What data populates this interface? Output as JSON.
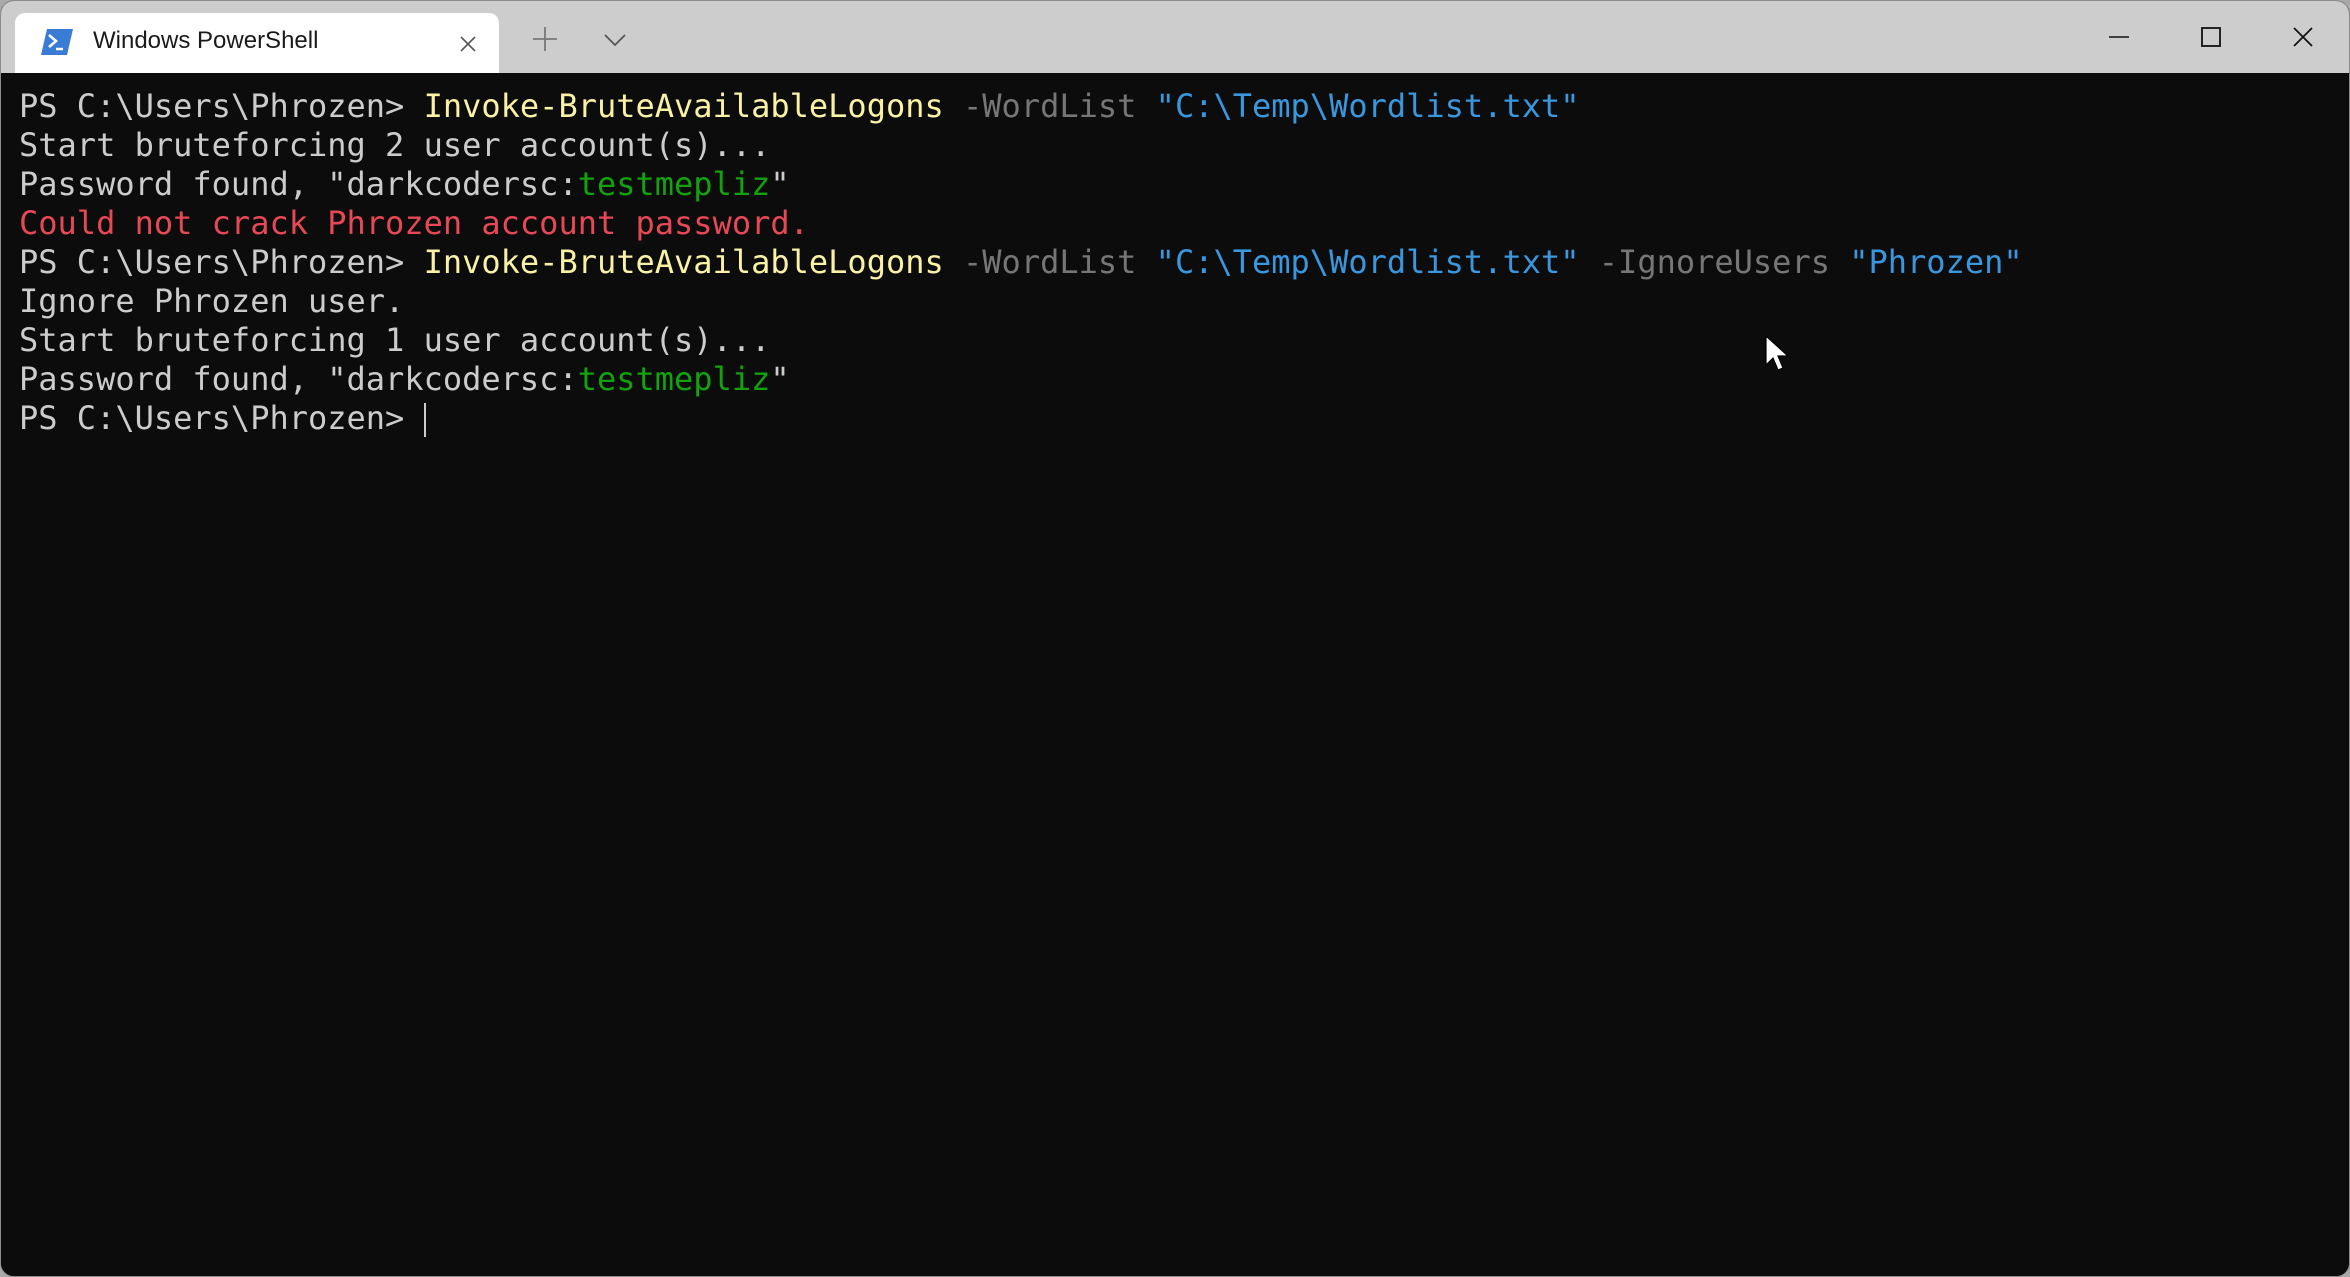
{
  "window": {
    "tab": {
      "title": "Windows PowerShell",
      "icon": "powershell-icon",
      "close_icon": "close-icon"
    },
    "new_tab_icon": "plus-icon",
    "dropdown_icon": "chevron-down-icon",
    "controls": {
      "minimize_icon": "minimize-icon",
      "maximize_icon": "maximize-icon",
      "close_icon": "close-icon"
    }
  },
  "colors": {
    "background": "#0c0c0c",
    "foreground": "#cccccc",
    "command": "#f9f1a5",
    "parameter": "#767676",
    "string": "#3a96dd",
    "success": "#13a10e",
    "error": "#e74856",
    "titlebar": "#cdcdcd"
  },
  "terminal": {
    "lines": [
      {
        "segments": [
          {
            "text": "PS C:\\Users\\Phrozen> ",
            "style": "default"
          },
          {
            "text": "Invoke-BruteAvailableLogons",
            "style": "cmd"
          },
          {
            "text": " -WordList",
            "style": "param"
          },
          {
            "text": " \"C:\\Temp\\Wordlist.txt\"",
            "style": "string"
          }
        ]
      },
      {
        "segments": [
          {
            "text": "Start bruteforcing 2 user account(s)...",
            "style": "default"
          }
        ]
      },
      {
        "segments": [
          {
            "text": "Password found, \"darkcodersc:",
            "style": "default"
          },
          {
            "text": "testmepliz",
            "style": "green"
          },
          {
            "text": "\"",
            "style": "default"
          }
        ]
      },
      {
        "segments": [
          {
            "text": "Could not crack Phrozen account password.",
            "style": "red"
          }
        ]
      },
      {
        "segments": [
          {
            "text": "PS C:\\Users\\Phrozen> ",
            "style": "default"
          },
          {
            "text": "Invoke-BruteAvailableLogons",
            "style": "cmd"
          },
          {
            "text": " -WordList",
            "style": "param"
          },
          {
            "text": " \"C:\\Temp\\Wordlist.txt\"",
            "style": "string"
          },
          {
            "text": " -IgnoreUsers",
            "style": "param"
          },
          {
            "text": " \"Phrozen\"",
            "style": "string"
          }
        ]
      },
      {
        "segments": [
          {
            "text": "Ignore Phrozen user.",
            "style": "default"
          }
        ]
      },
      {
        "segments": [
          {
            "text": "Start bruteforcing 1 user account(s)...",
            "style": "default"
          }
        ]
      },
      {
        "segments": [
          {
            "text": "Password found, \"darkcodersc:",
            "style": "default"
          },
          {
            "text": "testmepliz",
            "style": "green"
          },
          {
            "text": "\"",
            "style": "default"
          }
        ]
      },
      {
        "segments": [
          {
            "text": "PS C:\\Users\\Phrozen> ",
            "style": "default"
          }
        ],
        "cursor": true
      }
    ]
  }
}
